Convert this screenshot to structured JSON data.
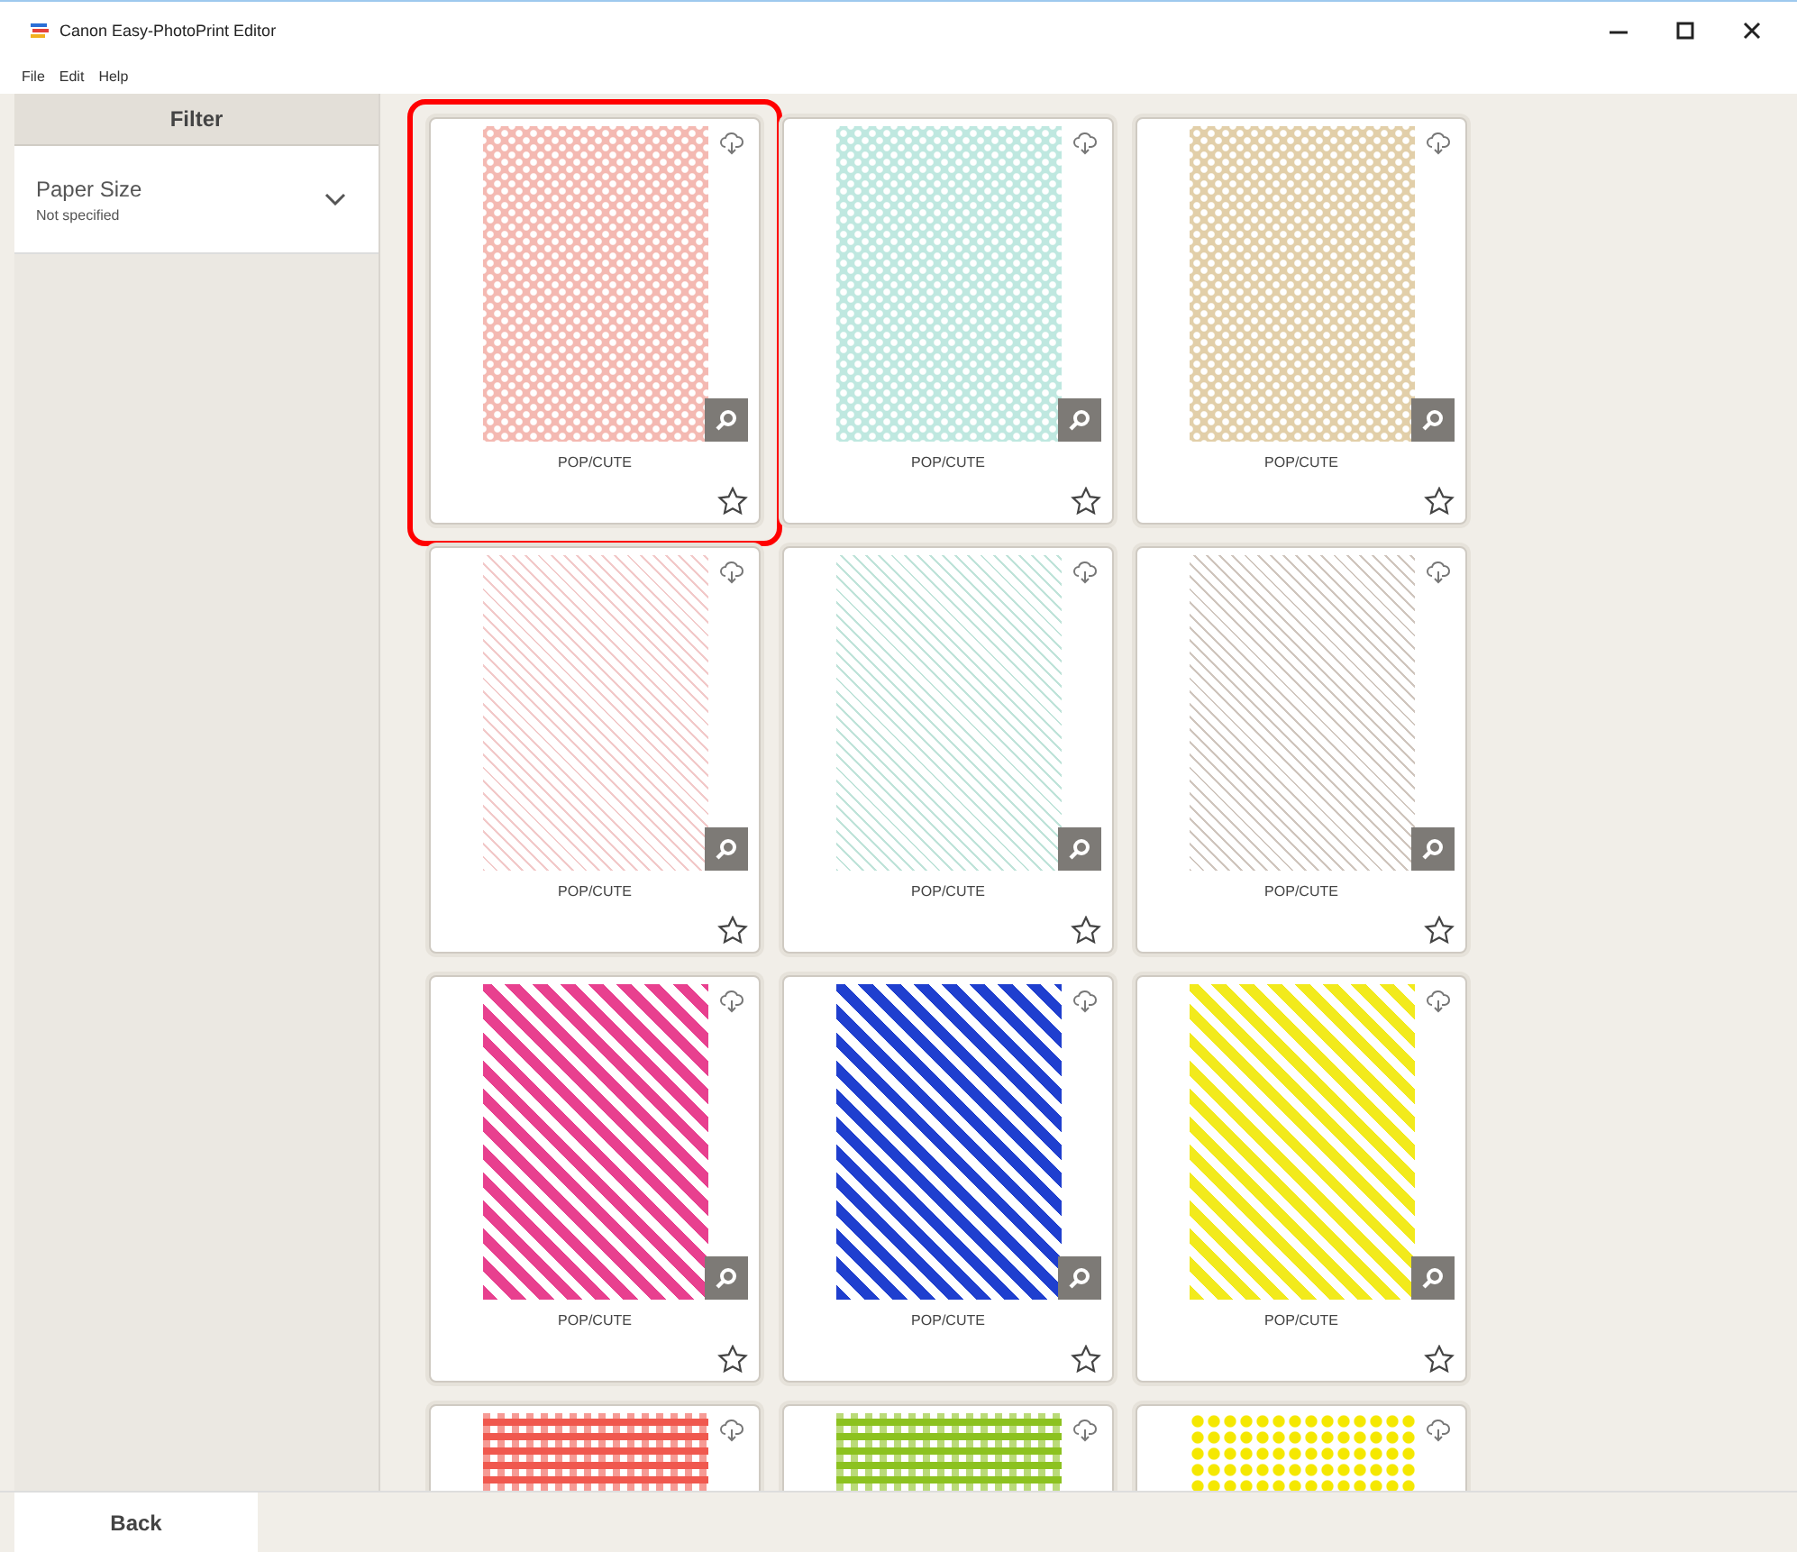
{
  "window": {
    "title": "Canon Easy-PhotoPrint Editor"
  },
  "menu": [
    "File",
    "Edit",
    "Help"
  ],
  "sidebar": {
    "header": "Filter",
    "filters": [
      {
        "label": "Paper Size",
        "value": "Not specified",
        "expanded": false
      }
    ]
  },
  "templates": [
    {
      "kind": "dots",
      "color": "#f4b9b2",
      "label": "POP/CUTE",
      "highlighted": true
    },
    {
      "kind": "dots",
      "color": "#bfe8e0",
      "label": "POP/CUTE",
      "highlighted": false
    },
    {
      "kind": "dots",
      "color": "#e2cfa9",
      "label": "POP/CUTE",
      "highlighted": false
    },
    {
      "kind": "thin-stripes",
      "color": "#f2c9c9",
      "label": "POP/CUTE",
      "highlighted": false
    },
    {
      "kind": "thin-stripes",
      "color": "#bfe3d9",
      "label": "POP/CUTE",
      "highlighted": false
    },
    {
      "kind": "thin-stripes",
      "color": "#cfc5bd",
      "label": "POP/CUTE",
      "highlighted": false
    },
    {
      "kind": "stripes",
      "color": "#e8408f",
      "label": "POP/CUTE",
      "highlighted": false
    },
    {
      "kind": "stripes",
      "color": "#1f3fcf",
      "label": "POP/CUTE",
      "highlighted": false
    },
    {
      "kind": "stripes",
      "color": "#f2ea1c",
      "label": "POP/CUTE",
      "highlighted": false
    },
    {
      "kind": "gingham",
      "color": "#f0584e",
      "highlighted": false
    },
    {
      "kind": "gingham",
      "color": "#8cc21f",
      "highlighted": false
    },
    {
      "kind": "big-dots",
      "color": "#f5e800",
      "highlighted": false
    }
  ],
  "footer": {
    "back": "Back"
  }
}
